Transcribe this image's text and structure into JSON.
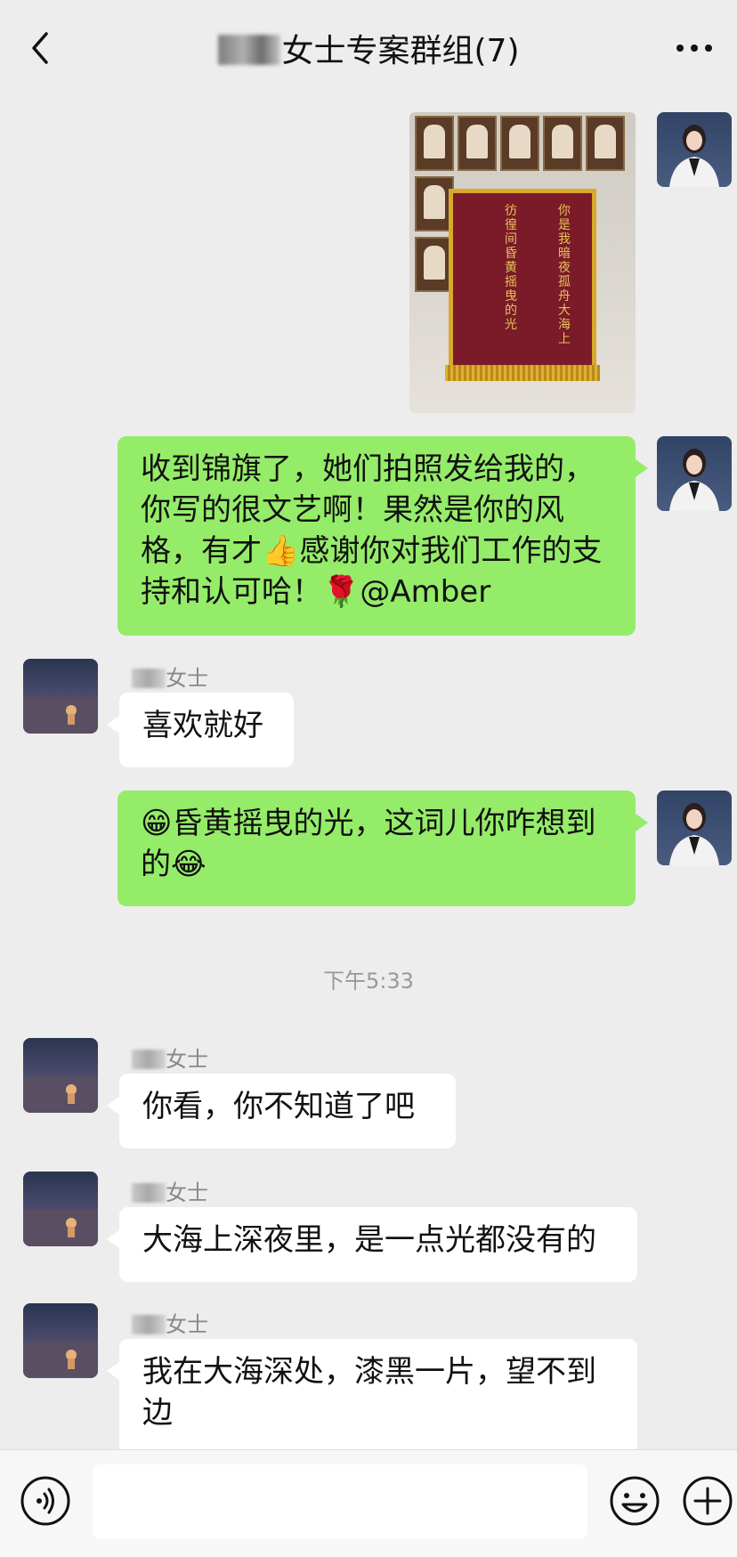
{
  "header": {
    "title": "女士专案群组(7)",
    "back_icon": "chevron-left-icon",
    "more_icon": "ellipsis-icon"
  },
  "photo_message": {
    "banner_lines": [
      "你是我暗夜孤舟大海上",
      "彷徨间昏黄摇曳的光"
    ]
  },
  "messages": [
    {
      "side": "self",
      "text": "收到锦旗了，她们拍照发给我的，你写的很文艺啊！果然是你的风格，有才👍感谢你对我们工作的支持和认可哈！🌹@Amber"
    },
    {
      "side": "other",
      "name": "女士",
      "text": "喜欢就好"
    },
    {
      "side": "self",
      "text": "😁昏黄摇曳的光，这词儿你咋想到的😂"
    },
    {
      "side": "other",
      "name": "女士",
      "text": "你看，你不知道了吧"
    },
    {
      "side": "other",
      "name": "女士",
      "text": "大海上深夜里，是一点光都没有的"
    },
    {
      "side": "other",
      "name": "女士",
      "text": "我在大海深处，漆黑一片，望不到边"
    }
  ],
  "timestamp": "下午5:33",
  "input_bar": {
    "voice_icon": "voice-icon",
    "emoji_icon": "emoji-icon",
    "plus_icon": "plus-icon",
    "value": ""
  }
}
